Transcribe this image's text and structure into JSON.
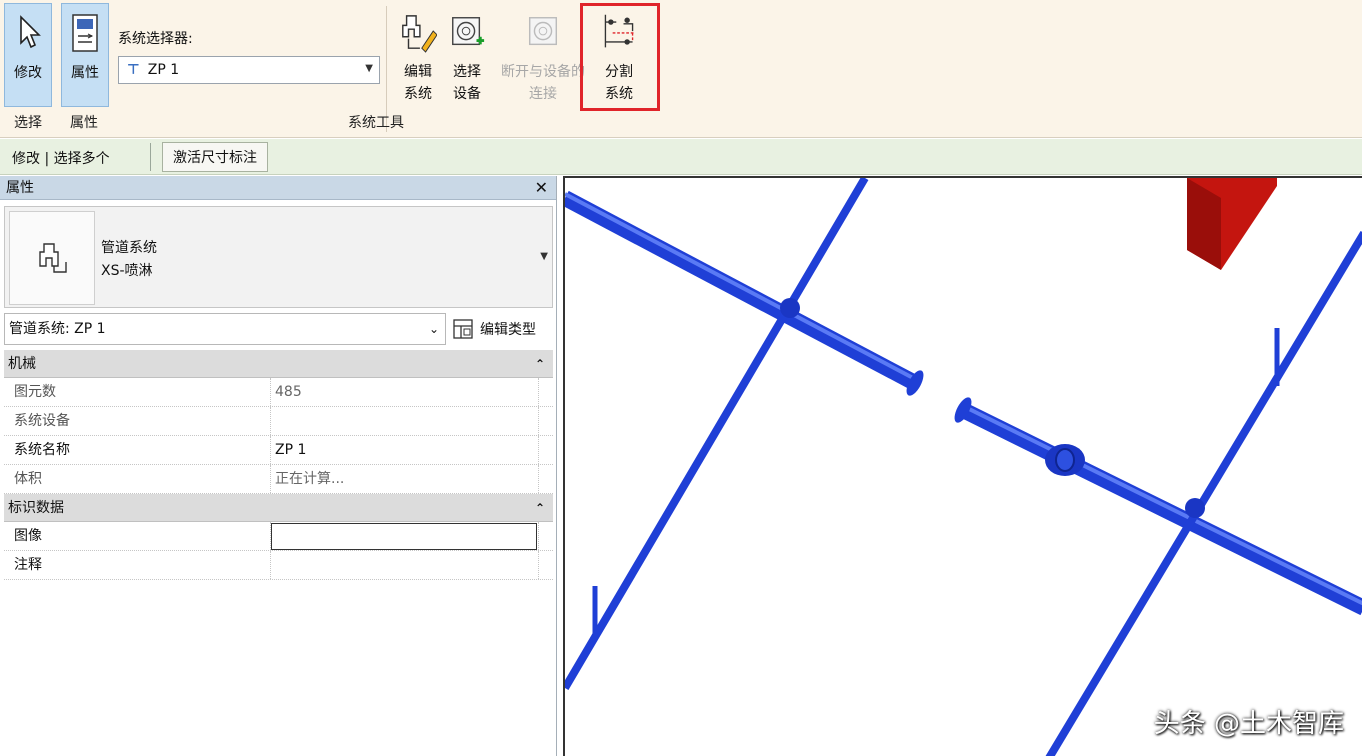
{
  "ribbon": {
    "modify_label": "修改",
    "properties_label": "属性",
    "system_selector_label": "系统选择器:",
    "system_selector_value": "ZP 1",
    "edit_system_l1": "编辑",
    "edit_system_l2": "系统",
    "select_equipment_l1": "选择",
    "select_equipment_l2": "设备",
    "disconnect_l1": "断开与设备的",
    "disconnect_l2": "连接",
    "divide_system_l1": "分割",
    "divide_system_l2": "系统",
    "group_select": "选择",
    "group_properties": "属性",
    "group_system_tools": "系统工具"
  },
  "context_bar": {
    "mode_text": "修改 | 选择多个",
    "tab_label": "激活尺寸标注"
  },
  "properties": {
    "title": "属性",
    "close_glyph": "✕",
    "type_family": "管道系统",
    "type_name": "XS-喷淋",
    "instance_selector": "管道系统: ZP 1",
    "edit_type_label": "编辑类型",
    "categories": [
      {
        "name": "机械",
        "rows": [
          {
            "key": "图元数",
            "value": "485"
          },
          {
            "key": "系统设备",
            "value": ""
          },
          {
            "key": "系统名称",
            "value": "ZP 1"
          },
          {
            "key": "体积",
            "value": "正在计算..."
          }
        ]
      },
      {
        "name": "标识数据",
        "rows": [
          {
            "key": "图像",
            "value": ""
          },
          {
            "key": "注释",
            "value": ""
          }
        ]
      }
    ]
  },
  "viewport": {
    "watermark": "头条 @土木智库"
  },
  "colors": {
    "pipe_blue": "#1f3fd6",
    "equipment_red": "#c4150f",
    "highlight_red": "#e0242a",
    "ribbon_bg": "#fbf4e8"
  }
}
